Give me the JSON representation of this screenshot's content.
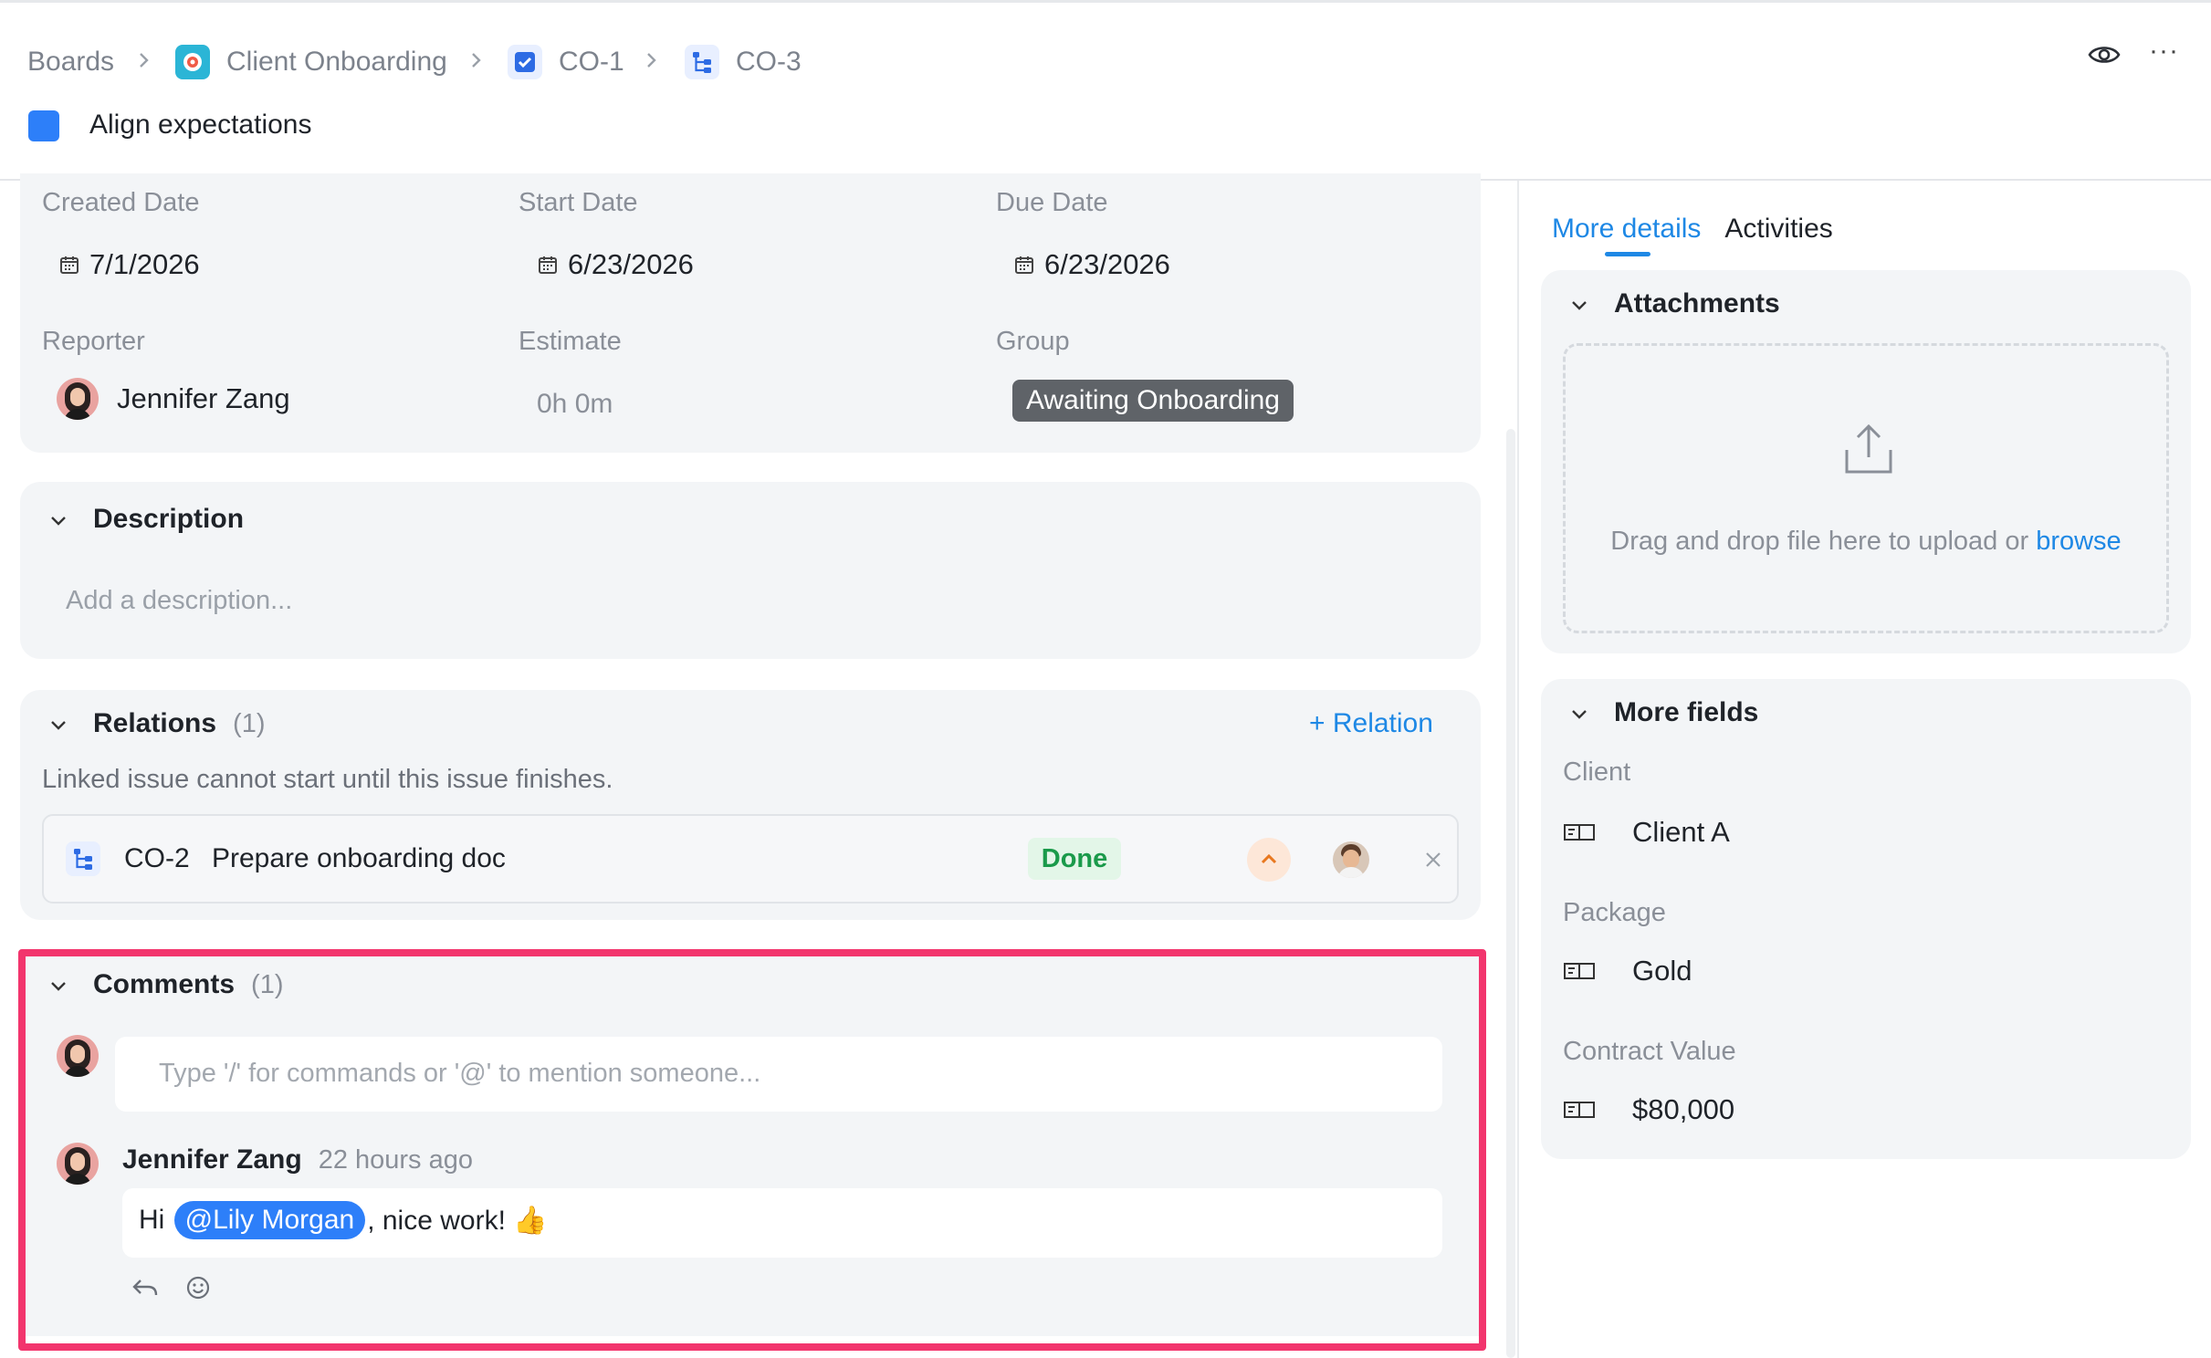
{
  "breadcrumb": {
    "items": [
      {
        "label": "Boards"
      },
      {
        "label": "Client Onboarding"
      },
      {
        "label": "CO-1"
      },
      {
        "label": "CO-3"
      }
    ]
  },
  "task": {
    "title": "Align expectations",
    "color": "#2d7ff9"
  },
  "fields": {
    "created_date_label": "Created Date",
    "created_date_value": "7/1/2026",
    "start_date_label": "Start Date",
    "start_date_value": "6/23/2026",
    "due_date_label": "Due Date",
    "due_date_value": "6/23/2026",
    "reporter_label": "Reporter",
    "reporter_value": "Jennifer Zang",
    "estimate_label": "Estimate",
    "estimate_value": "0h 0m",
    "group_label": "Group",
    "group_value": "Awaiting Onboarding"
  },
  "description": {
    "title": "Description",
    "placeholder": "Add a description..."
  },
  "relations": {
    "title": "Relations",
    "count": "(1)",
    "add_label": "+ Relation",
    "note": "Linked issue cannot start until this issue finishes.",
    "items": [
      {
        "key": "CO-2",
        "title": "Prepare onboarding doc",
        "status": "Done"
      }
    ]
  },
  "comments": {
    "title": "Comments",
    "count": "(1)",
    "input_placeholder": "Type '/' for commands or '@' to mention someone...",
    "items": [
      {
        "author": "Jennifer Zang",
        "time": "22 hours ago",
        "text_prefix": "Hi ",
        "mention": "@Lily Morgan",
        "text_suffix": ", nice work! 👍"
      }
    ]
  },
  "side": {
    "tabs": [
      {
        "label": "More details",
        "active": true
      },
      {
        "label": "Activities",
        "active": false
      }
    ],
    "attachments_title": "Attachments",
    "upload_text": "Drag and drop file here to upload or ",
    "upload_link": "browse",
    "more_fields_title": "More fields",
    "fields": [
      {
        "label": "Client",
        "value": "Client A"
      },
      {
        "label": "Package",
        "value": "Gold"
      },
      {
        "label": "Contract Value",
        "value": "$80,000"
      }
    ]
  },
  "colors": {
    "accent": "#1e88e5",
    "highlight_border": "#f2356d",
    "done_bg": "#e3f6e8",
    "done_fg": "#1a9a4a"
  }
}
